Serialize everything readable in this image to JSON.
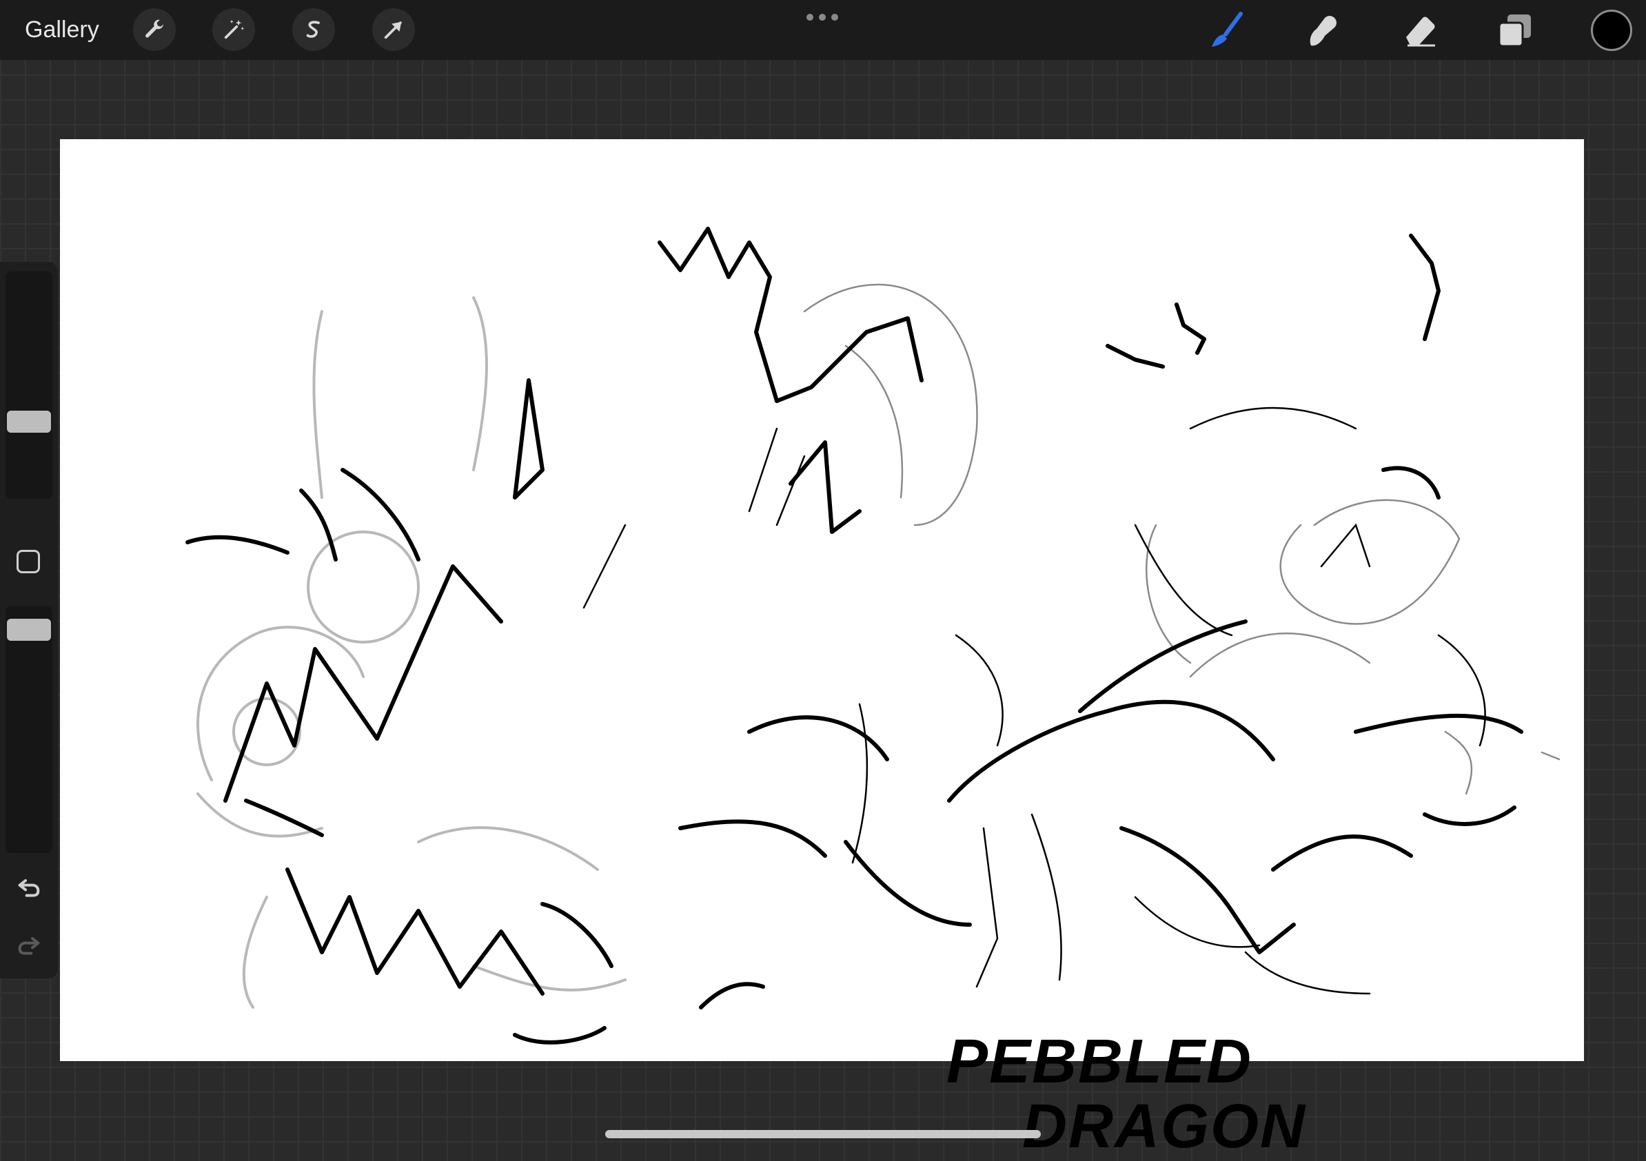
{
  "topbar": {
    "gallery_label": "Gallery",
    "left_tools": [
      "wrench-icon",
      "magic-wand-icon",
      "selection-s-icon",
      "transform-arrow-icon"
    ],
    "right_tools": [
      "brush-icon",
      "smudge-icon",
      "eraser-icon",
      "layers-icon"
    ],
    "active_tool": "brush-icon",
    "current_color": "#000000",
    "accent_color": "#2f6fe8"
  },
  "canvas": {
    "background": "#ffffff",
    "handwritten_text_line1": "PEBBLED",
    "handwritten_text_line2": "DRAGON"
  },
  "sidebar": {
    "controls": [
      "brush-size-slider",
      "modify-button",
      "opacity-slider",
      "undo-icon",
      "redo-icon"
    ]
  }
}
